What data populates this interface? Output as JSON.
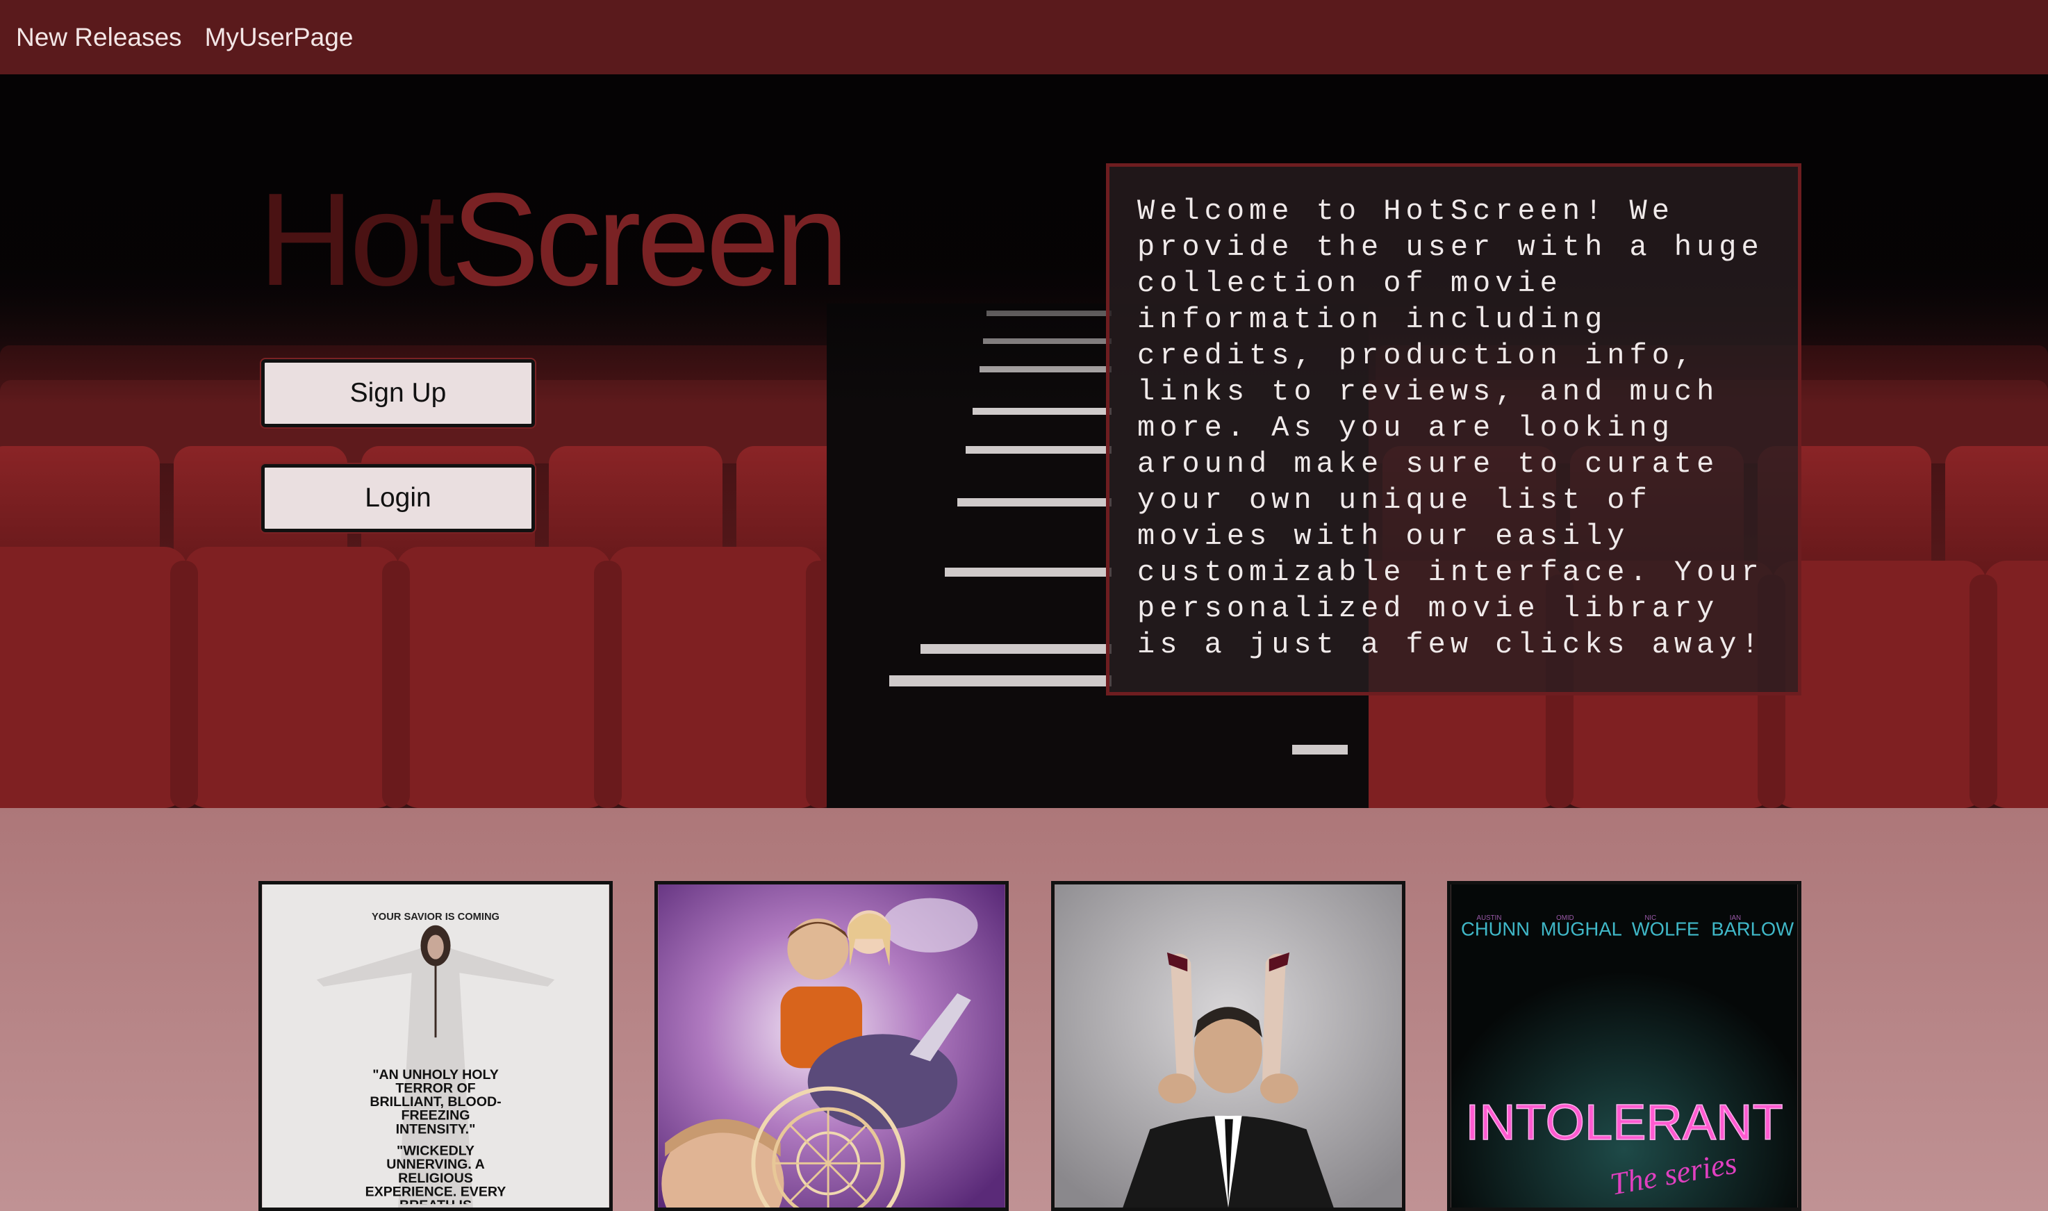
{
  "nav": {
    "new_releases": "New Releases",
    "my_user_page": "MyUserPage"
  },
  "hero": {
    "brand_hot": "Hot",
    "brand_screen": "Screen",
    "signup_label": "Sign Up",
    "login_label": "Login",
    "welcome_text": "Welcome to HotScreen! We provide the user with a huge collection of movie information including credits, production info, links to reviews, and much more. As you are looking around make sure to curate your own unique list of movies with our easily customizable interface. Your personalized movie library is a just a few clicks away!"
  },
  "posters": [
    {
      "tagline": "YOUR SAVIOR IS COMING",
      "quote1": "\"AN UNHOLY HOLY TERROR OF BRILLIANT, BLOOD-FREEZING INTENSITY.\"",
      "quote2": "\"WICKEDLY UNNERVING. A RELIGIOUS EXPERIENCE. EVERY BREATH IS SUSPENSEFUL.\""
    },
    {},
    {},
    {
      "cast": [
        "AUSTIN",
        "CHUNN",
        "OMID",
        "MUGHAL",
        "NIC",
        "WOLFE",
        "IAN",
        "BARLOW"
      ],
      "title": "INTOLERANT",
      "subtitle": "The series"
    }
  ],
  "colors": {
    "nav_bg": "#5a1a1c",
    "brand_dark": "#4a1213",
    "brand_red": "#7a2224",
    "button_bg": "#eadfe0",
    "section_bg": "#b07a7c"
  }
}
